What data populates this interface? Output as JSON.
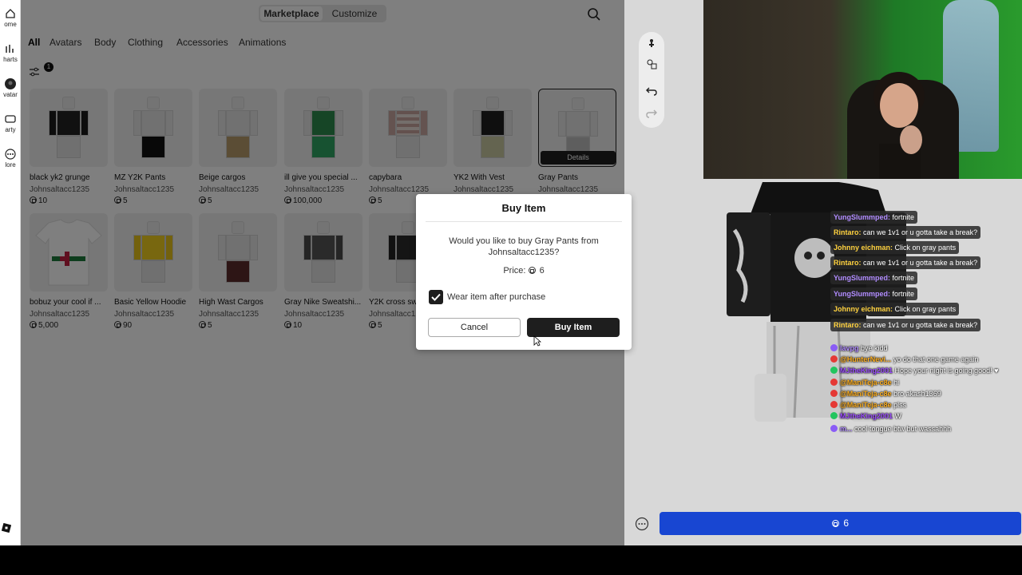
{
  "left_nav": {
    "items": [
      {
        "label": "ome",
        "icon": "home-icon"
      },
      {
        "label": "harts",
        "icon": "charts-icon"
      },
      {
        "label": "vatar",
        "icon": "avatar-icon"
      },
      {
        "label": "arty",
        "icon": "party-icon"
      },
      {
        "label": "lore",
        "icon": "more-icon"
      }
    ]
  },
  "topbar": {
    "tab_marketplace": "Marketplace",
    "tab_customize": "Customize"
  },
  "categories": [
    "All",
    "Avatars",
    "Body",
    "Clothing",
    "Accessories",
    "Animations"
  ],
  "filter_badge": "1",
  "items_row1": [
    {
      "name": "black yk2 grunge",
      "creator": "Johnsaltacc1235",
      "price": "10"
    },
    {
      "name": "MZ Y2K Pants",
      "creator": "Johnsaltacc1235",
      "price": "5"
    },
    {
      "name": "Beige cargos",
      "creator": "Johnsaltacc1235",
      "price": "5"
    },
    {
      "name": "ill give you special ...",
      "creator": "Johnsaltacc1235",
      "price": "100,000"
    },
    {
      "name": "capybara",
      "creator": "Johnsaltacc1235",
      "price": "5"
    },
    {
      "name": "YK2 With Vest",
      "creator": "Johnsaltacc1235",
      "price": "5"
    },
    {
      "name": "Gray Pants",
      "creator": "Johnsaltacc1235",
      "price": "",
      "details": "Details"
    }
  ],
  "items_row2": [
    {
      "name": "bobuz your cool if ...",
      "creator": "Johnsaltacc1235",
      "price": "5,000"
    },
    {
      "name": "Basic Yellow Hoodie",
      "creator": "Johnsaltacc1235",
      "price": "90"
    },
    {
      "name": "High Wast Cargos",
      "creator": "Johnsaltacc1235",
      "price": "5"
    },
    {
      "name": "Gray Nike Sweatshi...",
      "creator": "Johnsaltacc1235",
      "price": "10"
    },
    {
      "name": "Y2K cross sw",
      "creator": "Johnsaltacc1235",
      "price": "5"
    }
  ],
  "modal": {
    "title": "Buy Item",
    "question": "Would you like to buy Gray Pants  from Johnsaltacc1235?",
    "price_label": "Price:",
    "price_value": "6",
    "checkbox_label": "Wear item after purchase",
    "cancel": "Cancel",
    "buy": "Buy Item"
  },
  "buy_bar": {
    "price": "6"
  },
  "chat_pills": [
    {
      "user": "YungSlummped:",
      "user_color": "#b18cff",
      "text": "fortnite"
    },
    {
      "user": "Rintaro:",
      "user_color": "#ffd23f",
      "text": "can we 1v1 or u gotta take a break?"
    },
    {
      "user": "Johnny eichman:",
      "user_color": "#ffd23f",
      "text": "Click on gray pants"
    },
    {
      "user": "Rintaro:",
      "user_color": "#ffd23f",
      "text": "can we 1v1 or u gotta take a break?"
    },
    {
      "user": "YungSlummped:",
      "user_color": "#b18cff",
      "text": "fortnite"
    },
    {
      "user": "YungSlummped:",
      "user_color": "#b18cff",
      "text": "fortnite"
    },
    {
      "user": "Johnny eichman:",
      "user_color": "#ffd23f",
      "text": "Click on gray pants"
    },
    {
      "user": "Rintaro:",
      "user_color": "#ffd23f",
      "text": "can we 1v1 or u gotta take a break?"
    }
  ],
  "chat_lines": [
    {
      "user": "lavpg",
      "user_color": "#b18cff",
      "text": "bye kidd",
      "badge_color": "#8a5cf6"
    },
    {
      "user": "@HunterNevi...",
      "user_color": "#ffb020",
      "text": "yo do that one game again",
      "badge_color": "#e53935"
    },
    {
      "user": "MJtheKing2001",
      "user_color": "#9c4dff",
      "text": "Hope your night is going good! ♥",
      "badge_color": "#22c55e"
    },
    {
      "user": "@ManiTeja-c8e",
      "user_color": "#ffb020",
      "text": "hi",
      "badge_color": "#e53935"
    },
    {
      "user": "@ManiTeja-c8e",
      "user_color": "#ffb020",
      "text": "bro akash1369",
      "badge_color": "#e53935"
    },
    {
      "user": "@ManiTeja-c8e",
      "user_color": "#ffb020",
      "text": "plss",
      "badge_color": "#e53935"
    },
    {
      "user": "MJtheKing2001",
      "user_color": "#9c4dff",
      "text": "W",
      "badge_color": "#22c55e"
    },
    {
      "user": "m...",
      "user_color": "#b18cff",
      "text": "cool tongue btw but wassahhh",
      "badge_color": "#8a5cf6"
    }
  ]
}
